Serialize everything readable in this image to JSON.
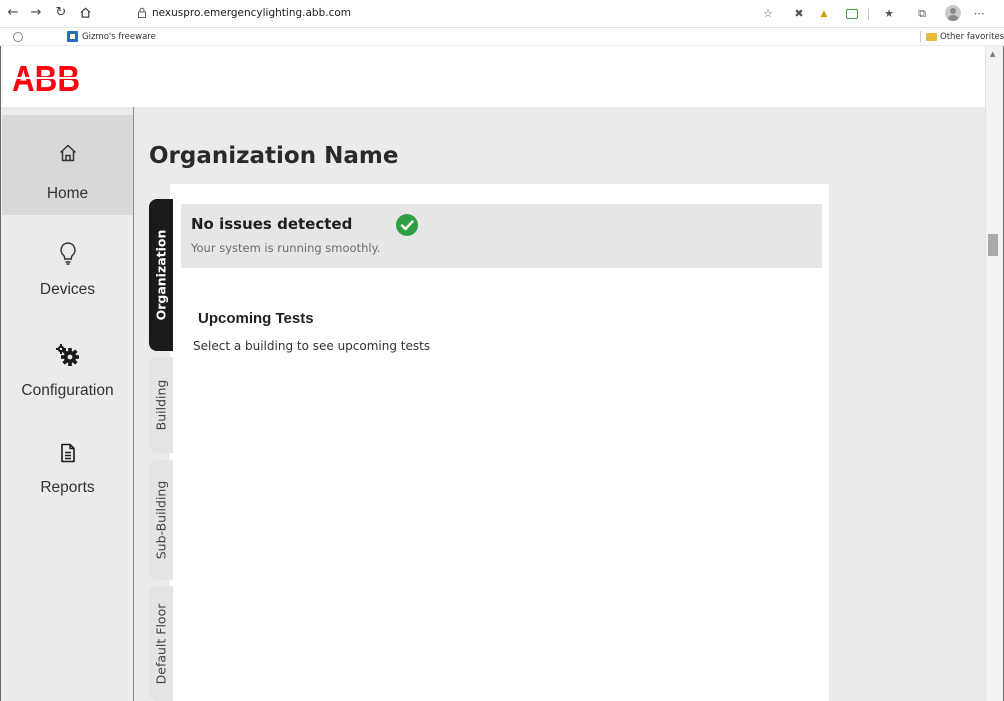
{
  "browser": {
    "url": "nexuspro.emergencylighting.abb.com",
    "favorites": [
      {
        "label": "Gizmo's freeware"
      }
    ],
    "other_favorites": "Other favorites"
  },
  "brand": {
    "logo_text": "ABB",
    "accent_color": "#ff000f"
  },
  "sidebar": {
    "items": [
      {
        "label": "Home",
        "icon": "home-icon",
        "active": true
      },
      {
        "label": "Devices",
        "icon": "lightbulb-icon",
        "active": false
      },
      {
        "label": "Configuration",
        "icon": "gears-icon",
        "active": false
      },
      {
        "label": "Reports",
        "icon": "document-icon",
        "active": false
      }
    ]
  },
  "main": {
    "title": "Organization Name",
    "tabs": [
      {
        "label": "Organization",
        "active": true
      },
      {
        "label": "Building",
        "active": false
      },
      {
        "label": "Sub-Building",
        "active": false
      },
      {
        "label": "Default Floor",
        "active": false
      }
    ],
    "status": {
      "title": "No issues detected",
      "subtitle": "Your system is running smoothly.",
      "icon": "check-circle-icon",
      "color": "#2ea043"
    },
    "upcoming": {
      "title": "Upcoming Tests",
      "subtitle": "Select a building to see upcoming tests"
    }
  }
}
